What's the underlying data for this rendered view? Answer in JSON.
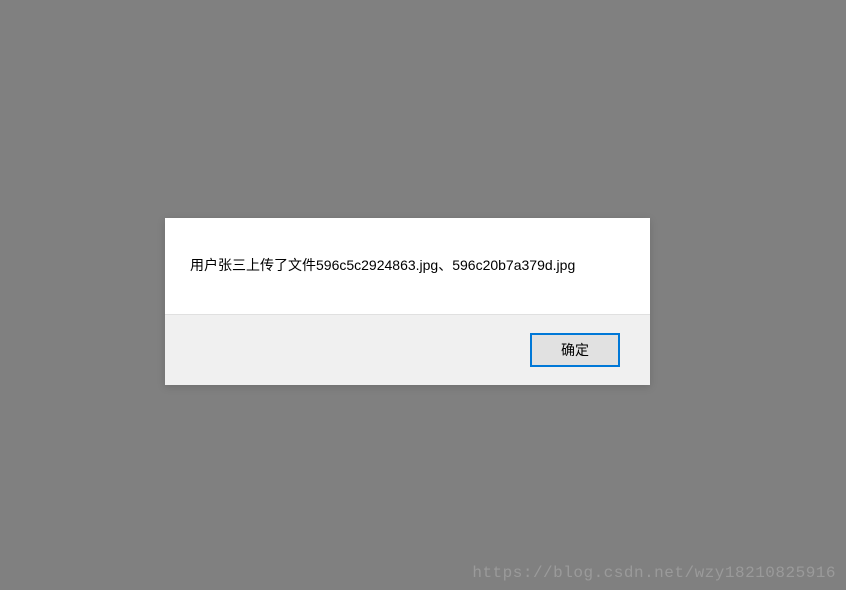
{
  "dialog": {
    "message": "用户张三上传了文件596c5c2924863.jpg、596c20b7a379d.jpg",
    "ok_label": "确定"
  },
  "watermark": "https://blog.csdn.net/wzy18210825916"
}
